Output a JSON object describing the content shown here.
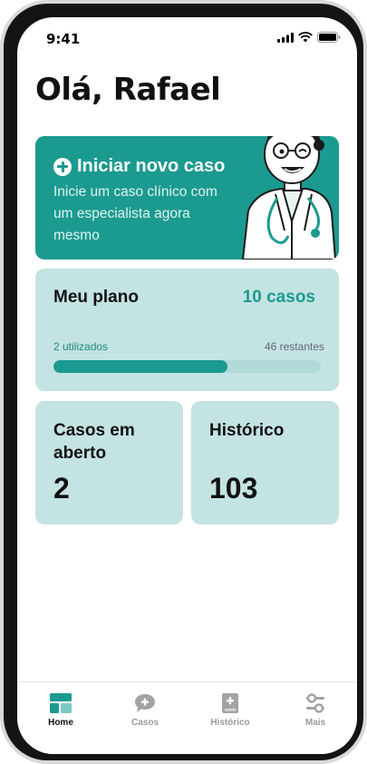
{
  "status_bar": {
    "time": "9:41"
  },
  "greeting": "Olá, Rafael",
  "hero": {
    "title": "Iniciar novo caso",
    "subtitle": "Inicie um caso clínico com um especialista agora mesmo"
  },
  "plan": {
    "title": "Meu plano",
    "count": "10 casos",
    "used": "2 utilizados",
    "remaining": "46 restantes",
    "progress_fraction": 0.65
  },
  "stats": [
    {
      "title": "Casos em aberto",
      "value": "2"
    },
    {
      "title": "Histórico",
      "value": "103"
    }
  ],
  "tabs": [
    {
      "label": "Home",
      "icon": "home-icon",
      "active": true
    },
    {
      "label": "Casos",
      "icon": "chat-plus-icon",
      "active": false
    },
    {
      "label": "Histórico",
      "icon": "book-plus-icon",
      "active": false
    },
    {
      "label": "Mais",
      "icon": "settings-sliders-icon",
      "active": false
    }
  ],
  "colors": {
    "accent": "#1b9a90",
    "card_light": "#c4e3e3",
    "progress_track": "#b0d9d8"
  }
}
